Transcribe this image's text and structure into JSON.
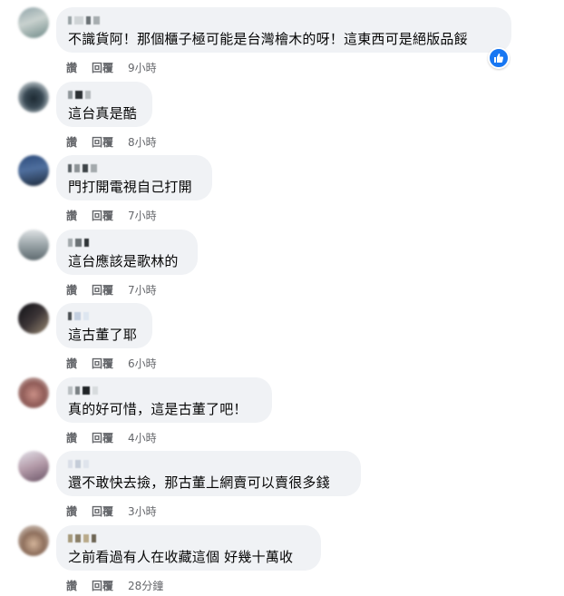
{
  "labels": {
    "like": "讚",
    "reply": "回覆"
  },
  "colors": {
    "bubble": "#f0f2f5",
    "meta": "#65676b",
    "like_badge": "#1877f2"
  },
  "comments": [
    {
      "text": "不識貨阿！那個櫃子極可能是台灣檜木的呀！這東西可是絕版品餒",
      "time": "9小時",
      "reaction": "like-icon"
    },
    {
      "text": "這台真是酷",
      "time": "8小時"
    },
    {
      "text": "門打開電視自己打開",
      "time": "7小時"
    },
    {
      "text": "這台應該是歌林的",
      "time": "7小時"
    },
    {
      "text": "這古董了耶",
      "time": "6小時"
    },
    {
      "text": "真的好可惜，這是古董了吧！",
      "time": "4小時"
    },
    {
      "text": "還不敢快去撿，那古董上網賣可以賣很多錢",
      "time": "3小時"
    },
    {
      "text": "之前看過有人在收藏這個 好幾十萬收",
      "time": "28分鐘"
    }
  ]
}
